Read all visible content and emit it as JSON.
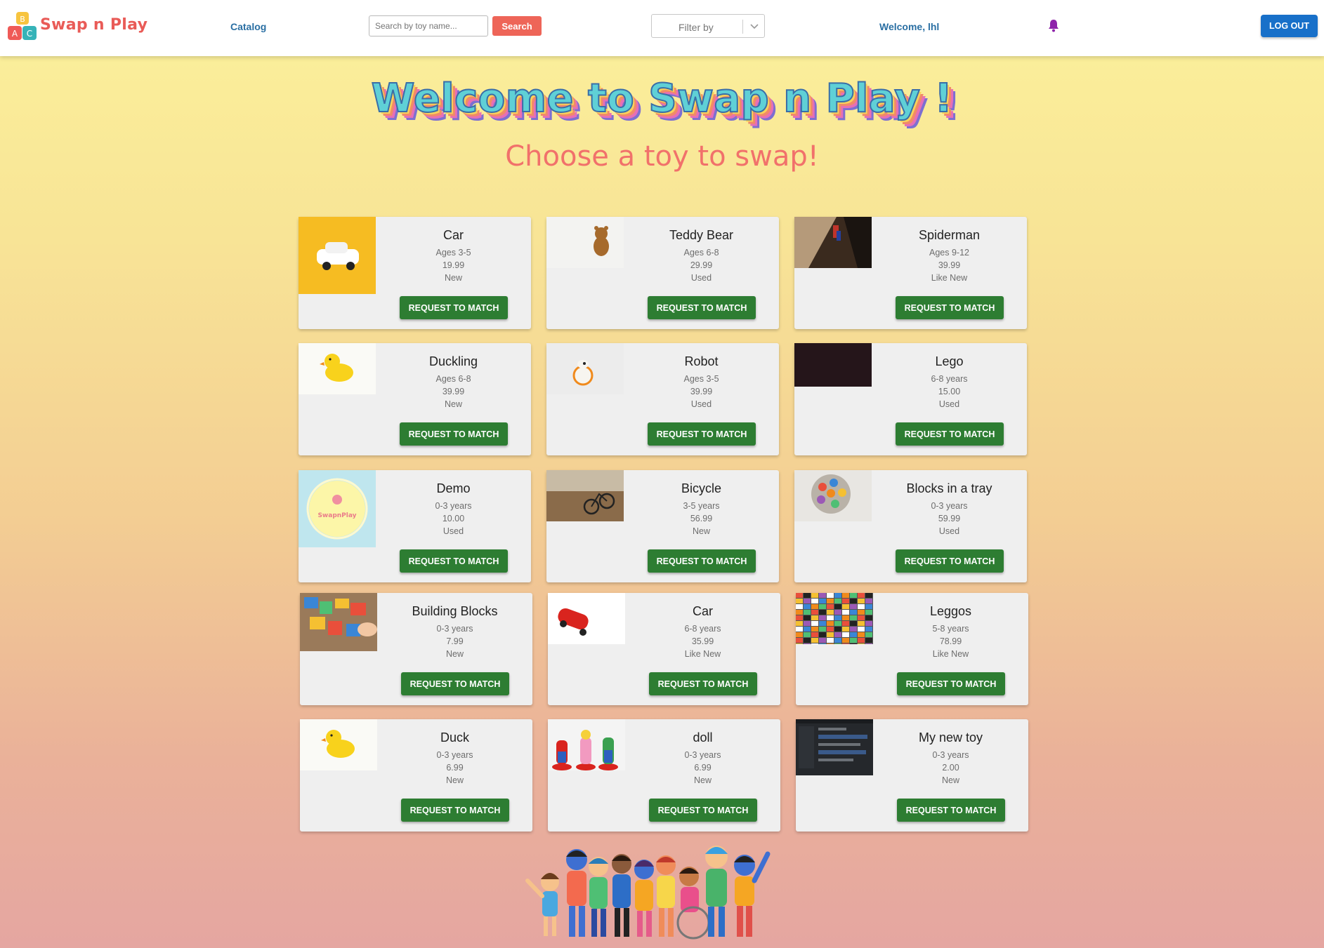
{
  "header": {
    "brand": "Swap n Play",
    "logo_letters": [
      "B",
      "A",
      "C"
    ],
    "catalog_link": "Catalog",
    "search_placeholder": "Search by toy name...",
    "search_button": "Search",
    "filter_label": "Filter by",
    "welcome": "Welcome, lhl",
    "logout_button": "LOG OUT"
  },
  "hero": {
    "title": "Welcome to Swap n Play !",
    "subtitle": "Choose a toy to swap!"
  },
  "toys": [
    {
      "name": "Car",
      "age": "Ages 3-5",
      "price": "19.99",
      "condition": "New",
      "button": "REQUEST TO MATCH",
      "image": "white-car-yellow"
    },
    {
      "name": "Teddy Bear",
      "age": "Ages 6-8",
      "price": "29.99",
      "condition": "Used",
      "button": "REQUEST TO MATCH",
      "image": "teddy-bear"
    },
    {
      "name": "Spiderman",
      "age": "Ages 9-12",
      "price": "39.99",
      "condition": "Like New",
      "button": "REQUEST TO MATCH",
      "image": "spiderman"
    },
    {
      "name": "Duckling",
      "age": "Ages 6-8",
      "price": "39.99",
      "condition": "New",
      "button": "REQUEST TO MATCH",
      "image": "rubber-duck"
    },
    {
      "name": "Robot",
      "age": "Ages 3-5",
      "price": "39.99",
      "condition": "Used",
      "button": "REQUEST TO MATCH",
      "image": "robot"
    },
    {
      "name": "Lego",
      "age": "6-8 years",
      "price": "15.00",
      "condition": "Used",
      "button": "REQUEST TO MATCH",
      "image": "dark"
    },
    {
      "name": "Demo",
      "age": "0-3 years",
      "price": "10.00",
      "condition": "Used",
      "button": "REQUEST TO MATCH",
      "image": "swapnplay-logo",
      "image_text": "SwapnPlay"
    },
    {
      "name": "Bicycle",
      "age": "3-5 years",
      "price": "56.99",
      "condition": "New",
      "button": "REQUEST TO MATCH",
      "image": "bicycle"
    },
    {
      "name": "Blocks in a tray",
      "age": "0-3 years",
      "price": "59.99",
      "condition": "Used",
      "button": "REQUEST TO MATCH",
      "image": "blocks-tray"
    },
    {
      "name": "Building Blocks",
      "age": "0-3 years",
      "price": "7.99",
      "condition": "New",
      "button": "REQUEST TO MATCH",
      "image": "building-blocks"
    },
    {
      "name": "Car",
      "age": "6-8 years",
      "price": "35.99",
      "condition": "Like New",
      "button": "REQUEST TO MATCH",
      "image": "red-car"
    },
    {
      "name": "Leggos",
      "age": "5-8 years",
      "price": "78.99",
      "condition": "Like New",
      "button": "REQUEST TO MATCH",
      "image": "lego-pile"
    },
    {
      "name": "Duck",
      "age": "0-3 years",
      "price": "6.99",
      "condition": "New",
      "button": "REQUEST TO MATCH",
      "image": "rubber-duck"
    },
    {
      "name": "doll",
      "age": "0-3 years",
      "price": "6.99",
      "condition": "New",
      "button": "REQUEST TO MATCH",
      "image": "mario-figures"
    },
    {
      "name": "My new toy",
      "age": "0-3 years",
      "price": "2.00",
      "condition": "New",
      "button": "REQUEST TO MATCH",
      "image": "screenshot"
    }
  ],
  "colors": {
    "brand": "#e95b57",
    "link": "#2a6fa3",
    "search_button": "#ee6558",
    "logout_button": "#1870c9",
    "match_button": "#2d7d32",
    "bell": "#8e24aa"
  },
  "icons": [
    "abc-blocks-logo",
    "chevron-down-icon",
    "bell-icon"
  ]
}
